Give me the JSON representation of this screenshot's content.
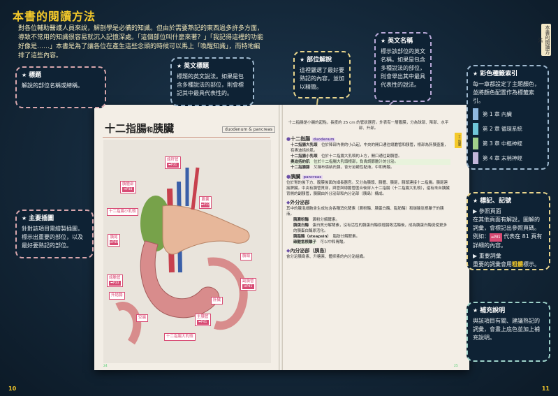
{
  "header": {
    "title": "本書的閱讀方法",
    "intro": "對各位輔助醫護人員來說，解剖學是必備的知識。但由於需要熟記的東西過多許多方面，導致不常用的知識很容易就沉入記憶深處。「這個部位叫什麼來著？」「我記得這裡的功能好像是……」本書是為了讓各位在產生這些念頭的時候可以馬上「喚醒知識」，而特地編排了這些內容。",
    "side_tab": "本書的閱讀方法",
    "page_left": "10",
    "page_right": "11"
  },
  "callouts": {
    "biaoti": {
      "title": "標題",
      "body": "解說的部位名稱或總稱。"
    },
    "en_title": {
      "title": "英文標題",
      "body": "標題的英文說法。如果是包含多種說法的部位，則會標記其中最具代表性的。"
    },
    "bulwei": {
      "title": "部位解說",
      "body": "這裡嚴選了最好要熟記的內容，並加以精簡。"
    },
    "en_name": {
      "title": "英文名稱",
      "body": "標示該部位的英文名稱。如果是包含多種說法的部位，則會舉出其中最具代表性的說法。"
    },
    "index": {
      "title": "彩色種籤索引",
      "body": "每一章都設定了主題顏色，並將顏色配置作為標籤索引。"
    },
    "illus": {
      "title": "主要插圖",
      "body": "針對該項目需繪製插圖，標示出重要的部位，以及最好要熟記的部位。"
    },
    "mark": {
      "title": "標記、記號",
      "ref_head": "▶ 參照頁面",
      "ref_body": "在其他頁面有解說，圖解的詞彙，會標記出參照頁碼。",
      "example_pre": "例如：",
      "example_chip": "➡P81",
      "example_post": "代表在 81 頁有詳細的內容。",
      "imp_head": "▶ 重要詞彙",
      "imp_body_pre": "重要的詞彙會用",
      "imp_body_bold": "粗體",
      "imp_body_post": "標示。"
    },
    "supp": {
      "title": "補充說明",
      "body": "與該項目有關、建議熟記的詞彙，會畫上底色並加上補充說明。"
    }
  },
  "legend": [
    {
      "label": "第 1 章 內臟",
      "color": "#8fb8e0"
    },
    {
      "label": "第 2 章 循環系統",
      "color": "#6fc6d8"
    },
    {
      "label": "第 3 章 中樞神經",
      "color": "#9fd08a"
    },
    {
      "label": "第 4 章 末梢神經",
      "color": "#c2b6d9"
    }
  ],
  "book": {
    "title_main": "十二指腸",
    "title_and": "和",
    "title_second": "胰臟",
    "title_en": "duodenum & pancreas",
    "labels": [
      {
        "text": "總肝管",
        "ref": "➡P31"
      },
      {
        "text": "胰體部",
        "ref": "➡P38"
      },
      {
        "text": "膽囊",
        "ref": "➡P32"
      },
      {
        "text": "十二指腸小乳頭",
        "ref": ""
      },
      {
        "text": "胰尾",
        "ref": "➡P40"
      },
      {
        "text": "總膽管",
        "ref": "➡P33"
      },
      {
        "text": "胰頭",
        "ref": ""
      },
      {
        "text": "副胰管",
        "ref": "➡P41"
      },
      {
        "text": "肝臟",
        "ref": ""
      },
      {
        "text": "升結腸",
        "ref": ""
      },
      {
        "text": "空腸",
        "ref": ""
      },
      {
        "text": "主胰管",
        "ref": "➡P41"
      },
      {
        "text": "十二指腸大乳頭",
        "ref": ""
      }
    ],
    "left_folio": "24",
    "right_folio": "25",
    "right": {
      "lead": "十二指腸是小腸的起點，長度約 25 cm 的管狀器官。外表有一層腹膜，分為球部、降部、水平部、升部。",
      "sec1_head": "十二指腸",
      "sec1_en": "duodenum",
      "sec1_items": [
        {
          "name": "十二指腸大乳頭",
          "text": "位於降部內側的小凸起，中央的開口通往總膽管和胰管，根部為肝胰壺腹，有奧迪括約肌。"
        },
        {
          "name": "十二指腸小乳頭",
          "text": "位於十二指腸大乳頭的上方，開口通往副胰管。"
        },
        {
          "name": "奧迪括約肌",
          "text": "位於十二指腸大乳頭根部，負責調節膽汁的分泌。"
        },
        {
          "name": "十二指腸腺",
          "text": "又稱布倫納氏腺，會分泌鹼性黏液，中和胃酸。"
        }
      ],
      "sec2_head": "胰臟",
      "sec2_en": "pancreas",
      "sec2_text": "位於胃的後下方、腹膜後面的細長器官。又分為胰頭、胰體、胰尾，胰頭連接十二指腸。胰尾連接脾臟。中央有胰管貫穿，與管與總膽管匯合後穿入十二指腸（十二指腸大乳頭），還有來自胰臟背側的副胰管，胰臟由外分泌部和內分泌部（胰島）構成。",
      "exo_head": "外分泌部",
      "exo_text": "其中的腺泡細胞會生成包含各種消化酵素（澱粉酶、胰蛋白酶、脂肪酶）和碳酸氫根離子的胰液。",
      "enzymes": [
        {
          "name": "胰澱粉酶",
          "text": "澱粉分解酵素。"
        },
        {
          "name": "胰蛋白酶",
          "text": "蛋白質分解酵素，沒有活性的胰蛋白酶原經腸致活酶後，成為胰蛋白酶促使更多的胰蛋白酶原活化。"
        },
        {
          "name": "胰脂酶（steapsin）",
          "text": "脂肪分解酵素。"
        },
        {
          "name": "碳酸氫根離子",
          "text": "可以中和胃酸。"
        }
      ],
      "endo_head": "內分泌部（胰島）",
      "endo_text": "會分泌胰島素、升糖素、體抑素的內分泌組織。",
      "tab_mark": "十二指腸"
    }
  }
}
